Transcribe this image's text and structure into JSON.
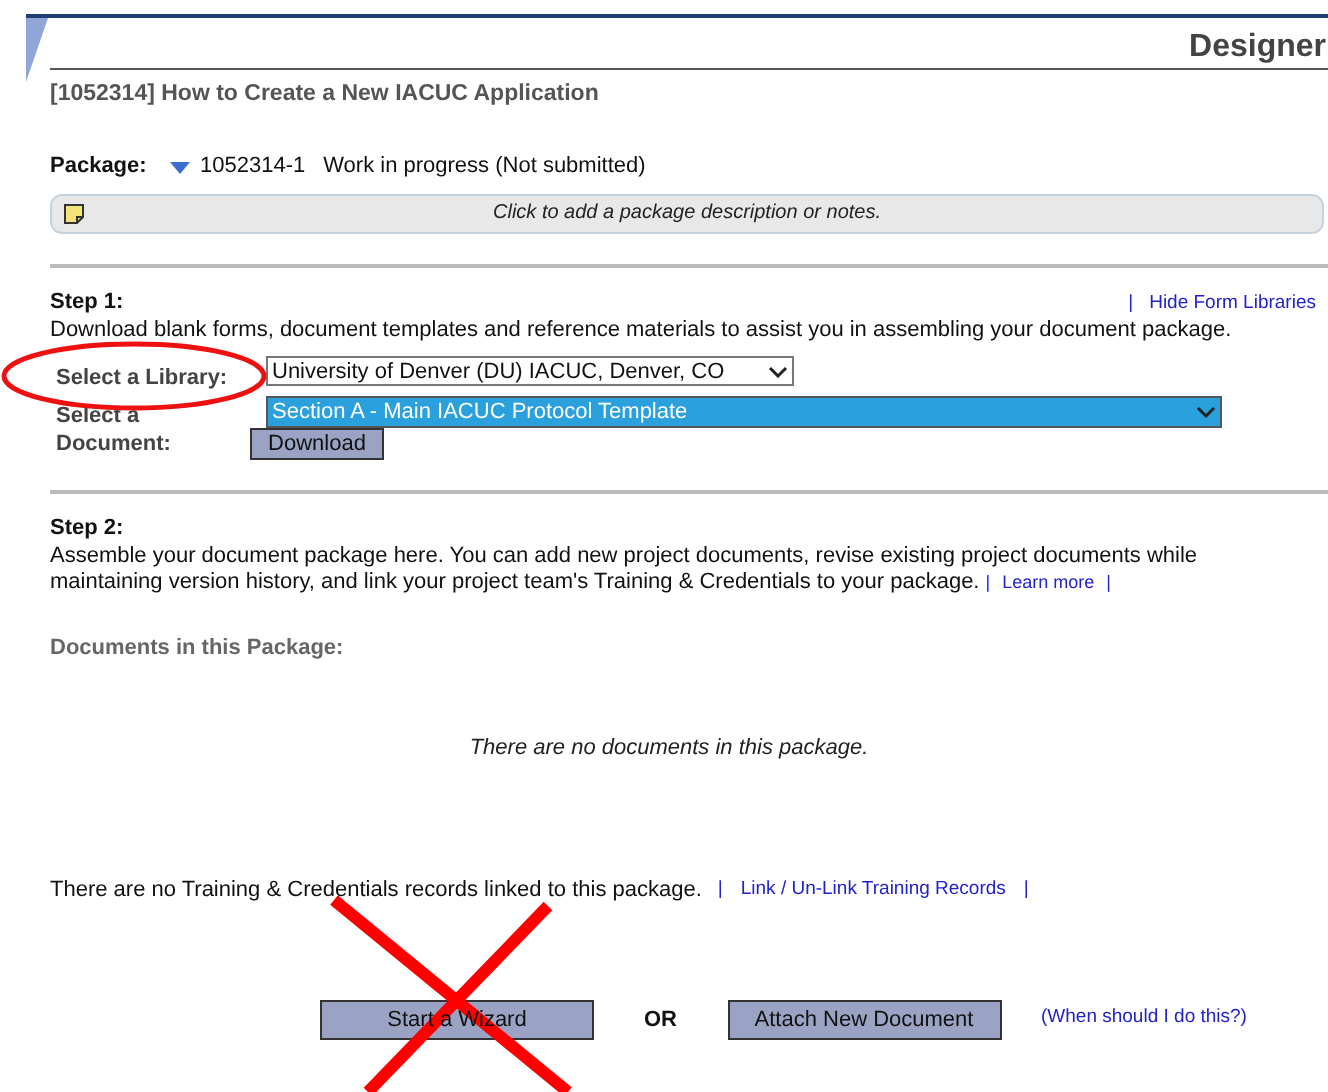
{
  "header": {
    "title": "Designer"
  },
  "package_title": "[1052314] How to Create a New IACUC Application",
  "package": {
    "label": "Package:",
    "number": "1052314-1",
    "status": "Work in progress (Not submitted)",
    "notes_prompt": "Click to add a package description or notes."
  },
  "step1": {
    "heading": "Step 1:",
    "link_separator": "|",
    "link": "Hide Form Libraries",
    "description": "Download blank forms, document templates and reference materials to assist you in assembling your document package.",
    "library_label": "Select a Library:",
    "library_value": "University of Denver (DU) IACUC, Denver, CO",
    "document_label": "Select a Document:",
    "document_value": "Section A - Main IACUC Protocol Template",
    "download_button": "Download"
  },
  "step2": {
    "heading": "Step 2:",
    "description": "Assemble your document package here. You can add new project documents, revise existing project documents while maintaining version history, and link your project team's Training & Credentials to your package.",
    "link_separators": [
      "|",
      "|"
    ],
    "link": "Learn more",
    "documents_heading": "Documents in this Package:",
    "empty_message": "There are no documents in this package.",
    "training_message": "There are no Training & Credentials records linked to this package.",
    "training_link_separators": [
      "|",
      "|"
    ],
    "training_link": "Link / Un-Link Training Records",
    "wizard_button": "Start a Wizard",
    "or_label": "OR",
    "attach_button": "Attach New Document",
    "help_link": "(When should I do this?)"
  }
}
